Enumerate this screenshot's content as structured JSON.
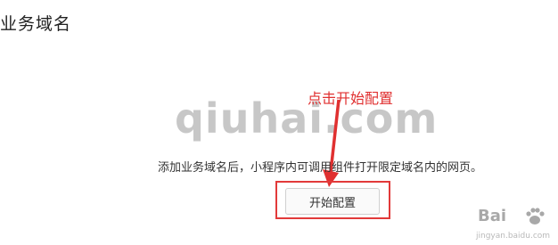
{
  "page": {
    "title": "业务域名",
    "description": "添加业务域名后，小程序内可调用组件打开限定域名内的网页。",
    "start_config_button": "开始配置"
  },
  "annotation": {
    "label": "点击开始配置",
    "color": "#e03030"
  },
  "watermarks": {
    "qiuhai": "qiuhai.com",
    "baidu_brand": "Bai",
    "baidu_sub": "jingyan.baidu.com"
  }
}
